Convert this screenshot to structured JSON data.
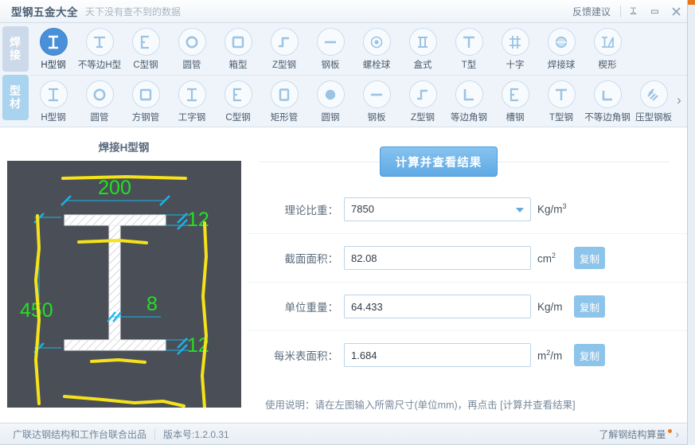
{
  "titlebar": {
    "app_title": "型钢五金大全",
    "slogan": "天下没有查不到的数据",
    "feedback": "反馈建议",
    "pin_icon": "pin-icon",
    "minimize_icon": "minimize-icon",
    "close_icon": "close-icon"
  },
  "category_tabs": [
    {
      "label_top": "焊",
      "label_bottom": "接",
      "active": false
    },
    {
      "label_top": "型",
      "label_bottom": "材",
      "active": true
    }
  ],
  "toolbar": {
    "row1": [
      {
        "label": "H型钢",
        "icon": "h-beam-icon",
        "selected": true
      },
      {
        "label": "不等边H型",
        "icon": "unequal-h-beam-icon",
        "selected": false
      },
      {
        "label": "C型钢",
        "icon": "c-channel-icon",
        "selected": false
      },
      {
        "label": "圆管",
        "icon": "round-pipe-icon",
        "selected": false
      },
      {
        "label": "箱型",
        "icon": "box-section-icon",
        "selected": false
      },
      {
        "label": "Z型钢",
        "icon": "z-section-icon",
        "selected": false
      },
      {
        "label": "钢板",
        "icon": "steel-plate-icon",
        "selected": false
      },
      {
        "label": "螺栓球",
        "icon": "bolt-ball-icon",
        "selected": false
      },
      {
        "label": "盒式",
        "icon": "box-type-icon",
        "selected": false
      },
      {
        "label": "T型",
        "icon": "t-section-icon",
        "selected": false
      },
      {
        "label": "十字",
        "icon": "cross-section-icon",
        "selected": false
      },
      {
        "label": "焊接球",
        "icon": "weld-ball-icon",
        "selected": false
      },
      {
        "label": "楔形",
        "icon": "wedge-icon",
        "selected": false
      }
    ],
    "row2": [
      {
        "label": "H型钢",
        "icon": "h-beam-icon",
        "selected": false
      },
      {
        "label": "圆管",
        "icon": "round-pipe-icon",
        "selected": false
      },
      {
        "label": "方钢管",
        "icon": "square-pipe-icon",
        "selected": false
      },
      {
        "label": "工字钢",
        "icon": "i-beam-icon",
        "selected": false
      },
      {
        "label": "C型钢",
        "icon": "c-channel-icon",
        "selected": false
      },
      {
        "label": "矩形管",
        "icon": "rect-pipe-icon",
        "selected": false
      },
      {
        "label": "圆钢",
        "icon": "round-bar-icon",
        "selected": false
      },
      {
        "label": "钢板",
        "icon": "steel-plate-icon",
        "selected": false
      },
      {
        "label": "Z型钢",
        "icon": "z-section-icon",
        "selected": false
      },
      {
        "label": "等边角钢",
        "icon": "equal-angle-icon",
        "selected": false
      },
      {
        "label": "槽钢",
        "icon": "channel-icon",
        "selected": false
      },
      {
        "label": "T型钢",
        "icon": "t-beam-icon",
        "selected": false
      },
      {
        "label": "不等边角钢",
        "icon": "unequal-angle-icon",
        "selected": false
      },
      {
        "label": "压型钢板",
        "icon": "profiled-sheet-icon",
        "selected": false
      }
    ],
    "next_icon": "chevron-right-icon"
  },
  "left": {
    "section_title": "焊接H型钢",
    "diagram": {
      "name": "welded-h-beam-cross-section",
      "dim_width": "200",
      "dim_height": "450",
      "dim_web": "8",
      "dim_flange_top": "12",
      "dim_flange_bottom": "12",
      "bg_color": "#4a4f57",
      "steel_color": "#ffffff",
      "dim_line_color": "#18b4e9",
      "dim_text_color": "#22e022",
      "annotation_color": "#f5e21a"
    }
  },
  "right": {
    "calc_button": "计算并查看结果",
    "fields": [
      {
        "label": "理论比重：",
        "value": "7850",
        "unit_main": "Kg/m",
        "unit_sup": "3",
        "dropdown": true,
        "copy": null
      },
      {
        "label": "截面面积：",
        "value": "82.08",
        "unit_main": "cm",
        "unit_sup": "2",
        "dropdown": false,
        "copy": "复制"
      },
      {
        "label": "单位重量：",
        "value": "64.433",
        "unit_main": "Kg/m",
        "unit_sup": "",
        "dropdown": false,
        "copy": "复制"
      },
      {
        "label": "每米表面积：",
        "value": "1.684",
        "unit_main": "m",
        "unit_sup": "2",
        "unit_tail": "/m",
        "dropdown": false,
        "copy": "复制"
      }
    ],
    "usage_note": "使用说明：请在左图输入所需尺寸(单位mm)，再点击 [计算并查看结果]"
  },
  "statusbar": {
    "producer": "广联达钢结构和工作台联合出品",
    "version": "版本号:1.2.0.31",
    "link": "了解钢结构算量",
    "chevron_icon": "chevron-right-icon"
  }
}
